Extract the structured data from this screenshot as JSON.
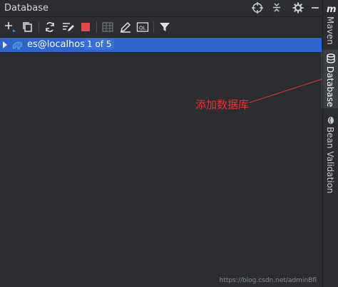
{
  "window": {
    "title": "Database"
  },
  "titlebar": {
    "icons": [
      "crosshair-icon",
      "collapse-icon",
      "gear-icon",
      "minimize-icon"
    ]
  },
  "toolbar": {
    "icons": [
      "add-icon",
      "copy-icon",
      "refresh-icon",
      "edit-settings-icon",
      "stop-icon",
      "table-icon",
      "pencil-icon",
      "ql-console-icon",
      "filter-icon"
    ],
    "colors": {
      "stop": "#e04a4a",
      "refresh": "#dfe1e5"
    }
  },
  "tree": {
    "items": [
      {
        "label": "es@localhost",
        "badge": "1 of 5",
        "selected": true
      }
    ],
    "colors": {
      "selection": "#2f65ca"
    }
  },
  "sidebar_right": {
    "tabs": [
      {
        "label": "Maven",
        "icon": "maven-icon"
      },
      {
        "label": "Database",
        "icon": "database-icon",
        "active": true
      },
      {
        "label": "Bean Validation",
        "icon": "bean-icon"
      }
    ]
  },
  "annotation": {
    "text": "添加数据库",
    "color": "#e2363a"
  },
  "watermark": {
    "text": "https://blog.csdn.net/adminBfl"
  }
}
